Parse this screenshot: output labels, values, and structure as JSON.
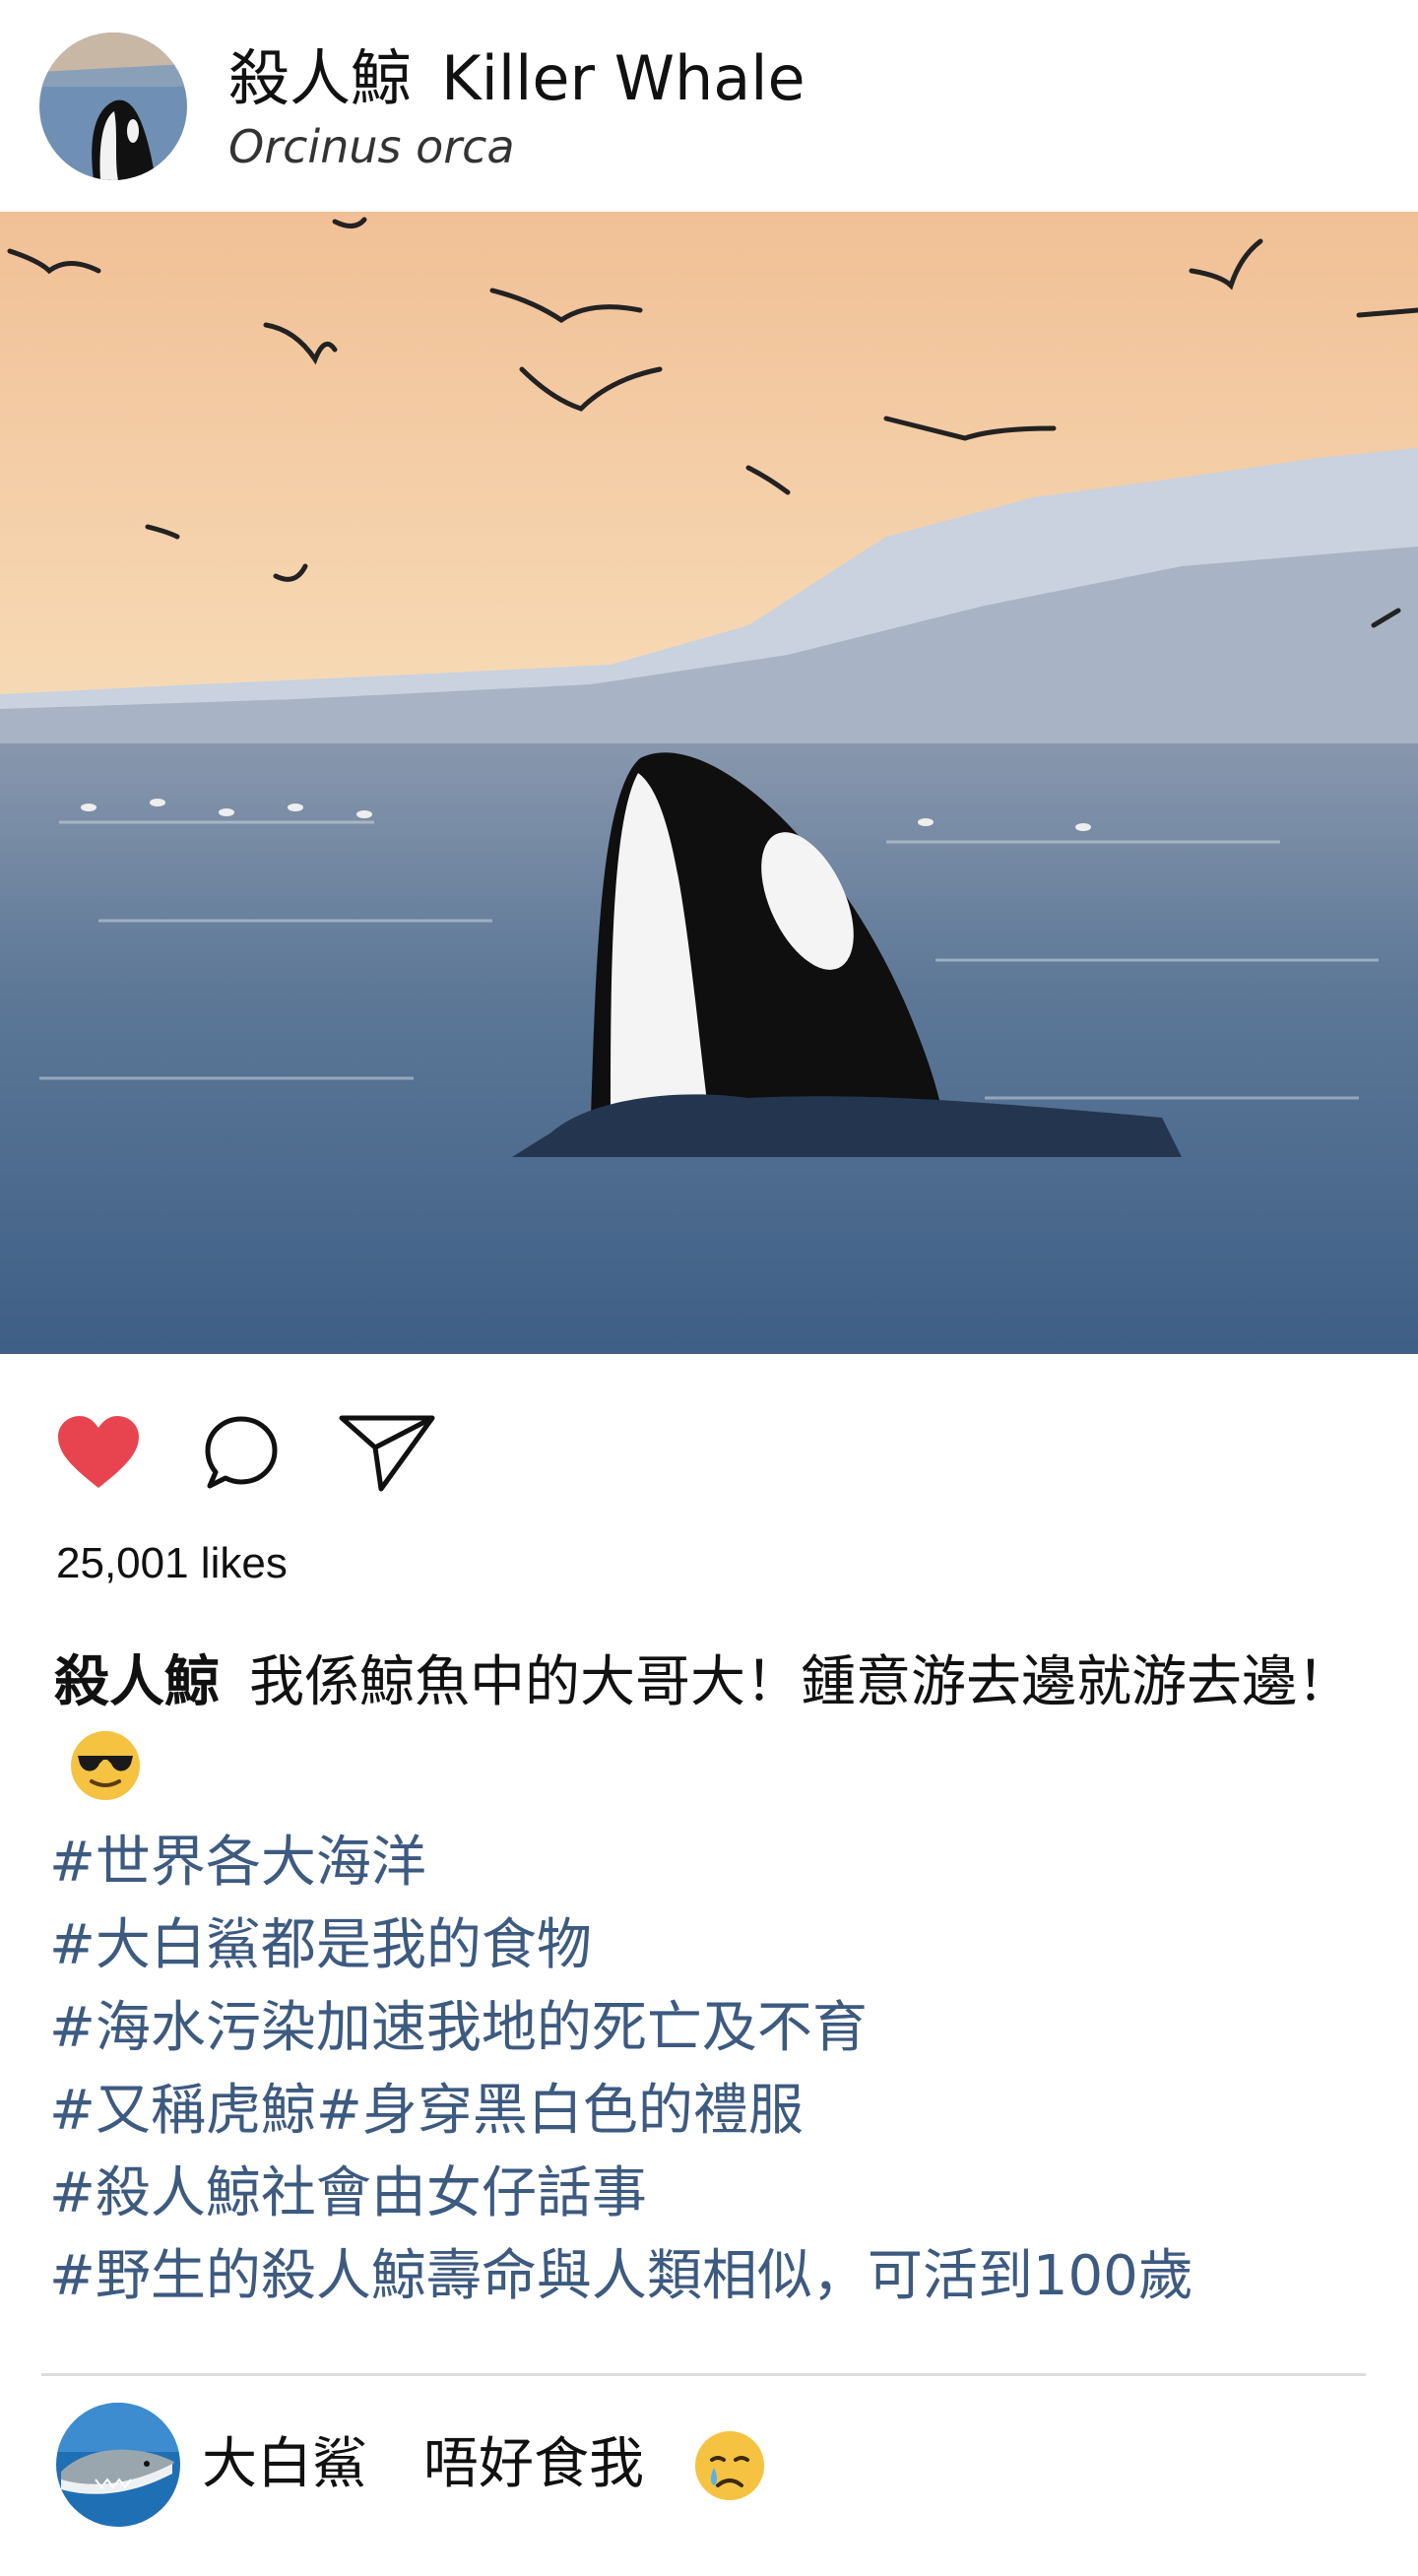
{
  "post": {
    "author_zh": "殺人鯨",
    "author_en": "Killer Whale",
    "scientific_name": "Orcinus orca"
  },
  "photo": {
    "subject": "orca-spyhopping-at-sunset",
    "colors": {
      "sky_top": "#f2c79a",
      "sky_bottom": "#f6d9b3",
      "water": "#4b6a8f",
      "orca": "#111111"
    }
  },
  "actions": {
    "like_icon": "heart-icon",
    "like_color": "#e8444f",
    "comment_icon": "comment-bubble-icon",
    "share_icon": "paper-plane-icon"
  },
  "likes_text": "25,001 likes",
  "caption": {
    "author": "殺人鯨",
    "text": "我係鯨魚中的大哥大！鍾意游去邊就游去邊！",
    "emoji": "sunglasses-face-emoji"
  },
  "hashtags": [
    "#世界各大海洋",
    "#大白鯊都是我的食物",
    "#海水污染加速我地的死亡及不育",
    "#又稱虎鯨#身穿黑白色的禮服",
    "#殺人鯨社會由女仔話事",
    "#野生的殺人鯨壽命與人類相似，可活到100歲"
  ],
  "hashtag_color": "#3d5a80",
  "comment": {
    "author": "大白鯊",
    "text": "唔好食我",
    "emoji": "crying-face-emoji"
  }
}
